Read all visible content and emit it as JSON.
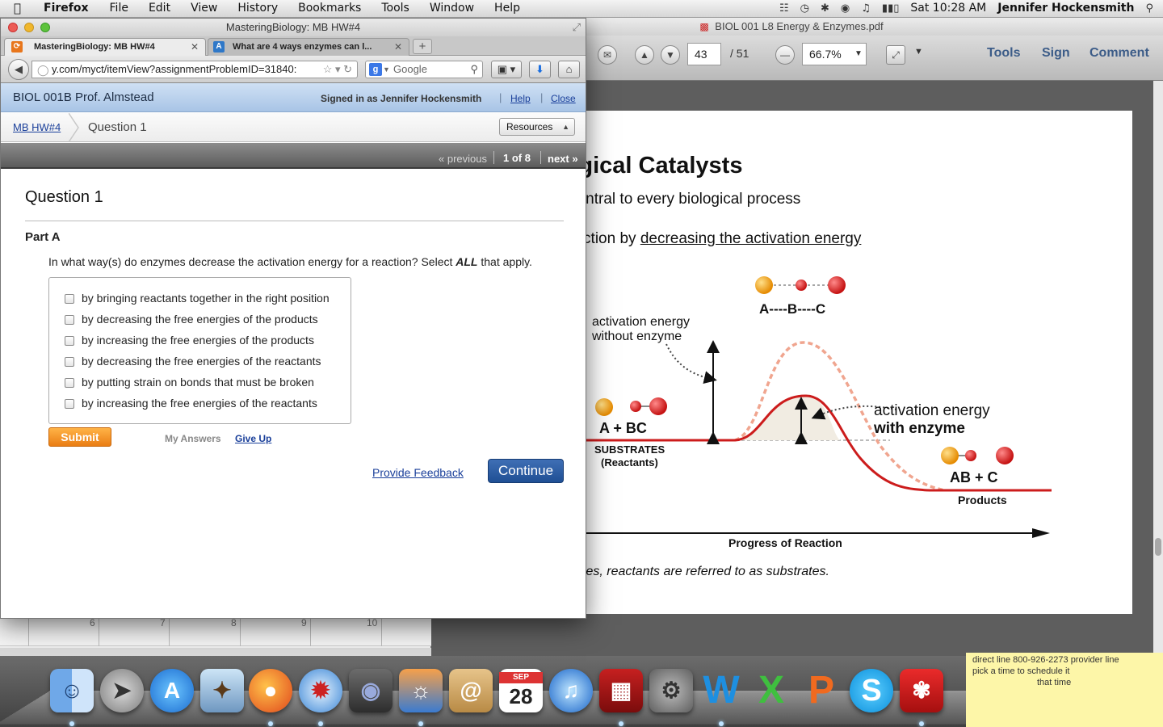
{
  "menubar": {
    "app": "Firefox",
    "menus": [
      "File",
      "Edit",
      "View",
      "History",
      "Bookmarks",
      "Tools",
      "Window",
      "Help"
    ],
    "clock": "Sat 10:28 AM",
    "user": "Jennifer Hockensmith",
    "status_icons": [
      "screen-sharing-icon",
      "time-machine-icon",
      "bluetooth-icon",
      "wifi-icon",
      "volume-icon",
      "battery-icon"
    ]
  },
  "pdf": {
    "window_title": "BIOL 001 L8 Energy & Enzymes.pdf",
    "page_current": "43",
    "page_total": "/ 51",
    "zoom": "66.7%",
    "tools_links": [
      "Tools",
      "Sign",
      "Comment"
    ],
    "heading": "ymes: Biological Catalysts",
    "line1": "mes are catalysts central to every biological process",
    "line2_prefix": "ase the rate of a reaction by ",
    "line2_underlined": "decreasing the activation energy",
    "diagram": {
      "label_abc": "A----B----C",
      "label_without_1": "activation energy",
      "label_without_2": "without enzyme",
      "label_with_1": "activation energy",
      "label_with_2": "with enzyme",
      "label_reactants": "A  +  BC",
      "label_substrates": "SUBSTRATES",
      "label_substrates_sub": "(Reactants)",
      "label_products_formula": "AB  +  C",
      "label_products": "Products",
      "x_axis": "Progress of Reaction"
    },
    "note": "hen talking about enzymes, reactants are referred to as substrates."
  },
  "firefox": {
    "window_title": "MasteringBiology: MB HW#4",
    "tabs": [
      {
        "label": "MasteringBiology: MB HW#4",
        "active": true
      },
      {
        "label": "What are 4 ways enzymes can l...",
        "active": false
      }
    ],
    "url": "y.com/myct/itemView?assignmentProblemID=31840:",
    "search_placeholder": "Google"
  },
  "mastering": {
    "course": "BIOL 001B Prof. Almstead",
    "signed_in": "Signed in as Jennifer Hockensmith",
    "help": "Help",
    "close": "Close",
    "breadcrumb_link": "MB HW#4",
    "breadcrumb_current": "Question 1",
    "resources": "Resources",
    "pager": {
      "previous": "« previous",
      "count": "1 of 8",
      "next": "next »"
    },
    "question_title": "Question 1",
    "part": "Part A",
    "prompt_before": "In what way(s) do enzymes decrease the activation energy for a reaction?  Select ",
    "prompt_emph": "ALL",
    "prompt_after": " that apply.",
    "options": [
      "by bringing reactants together in the right position",
      "by decreasing the free energies of the products",
      "by increasing the free energies of the products",
      "by decreasing the free energies of the reactants",
      "by putting strain on bonds that must be broken",
      "by increasing the free energies of the reactants"
    ],
    "submit": "Submit",
    "my_answers": "My Answers",
    "give_up": "Give Up",
    "feedback": "Provide Feedback",
    "continue": "Continue"
  },
  "sheet": {
    "ruler": [
      "6",
      "7",
      "8",
      "9",
      "10"
    ]
  },
  "sticky": {
    "line1": "direct line 800-926-2273 provider line",
    "line2": "pick a time to schedule it",
    "line3": "that time"
  },
  "dock": {
    "items": [
      "finder-icon",
      "launchpad-icon",
      "app-store-icon",
      "preview-icon",
      "firefox-icon",
      "safari-icon",
      "facetime-icon",
      "iphoto-icon",
      "contacts-icon",
      "calendar-icon",
      "itunes-icon",
      "photo-booth-icon",
      "system-preferences-icon",
      "word-icon",
      "excel-icon",
      "powerpoint-icon",
      "skype-icon",
      "acrobat-icon",
      "stickies-icon",
      "trash-icon"
    ],
    "calendar_month": "SEP",
    "calendar_day": "28"
  }
}
